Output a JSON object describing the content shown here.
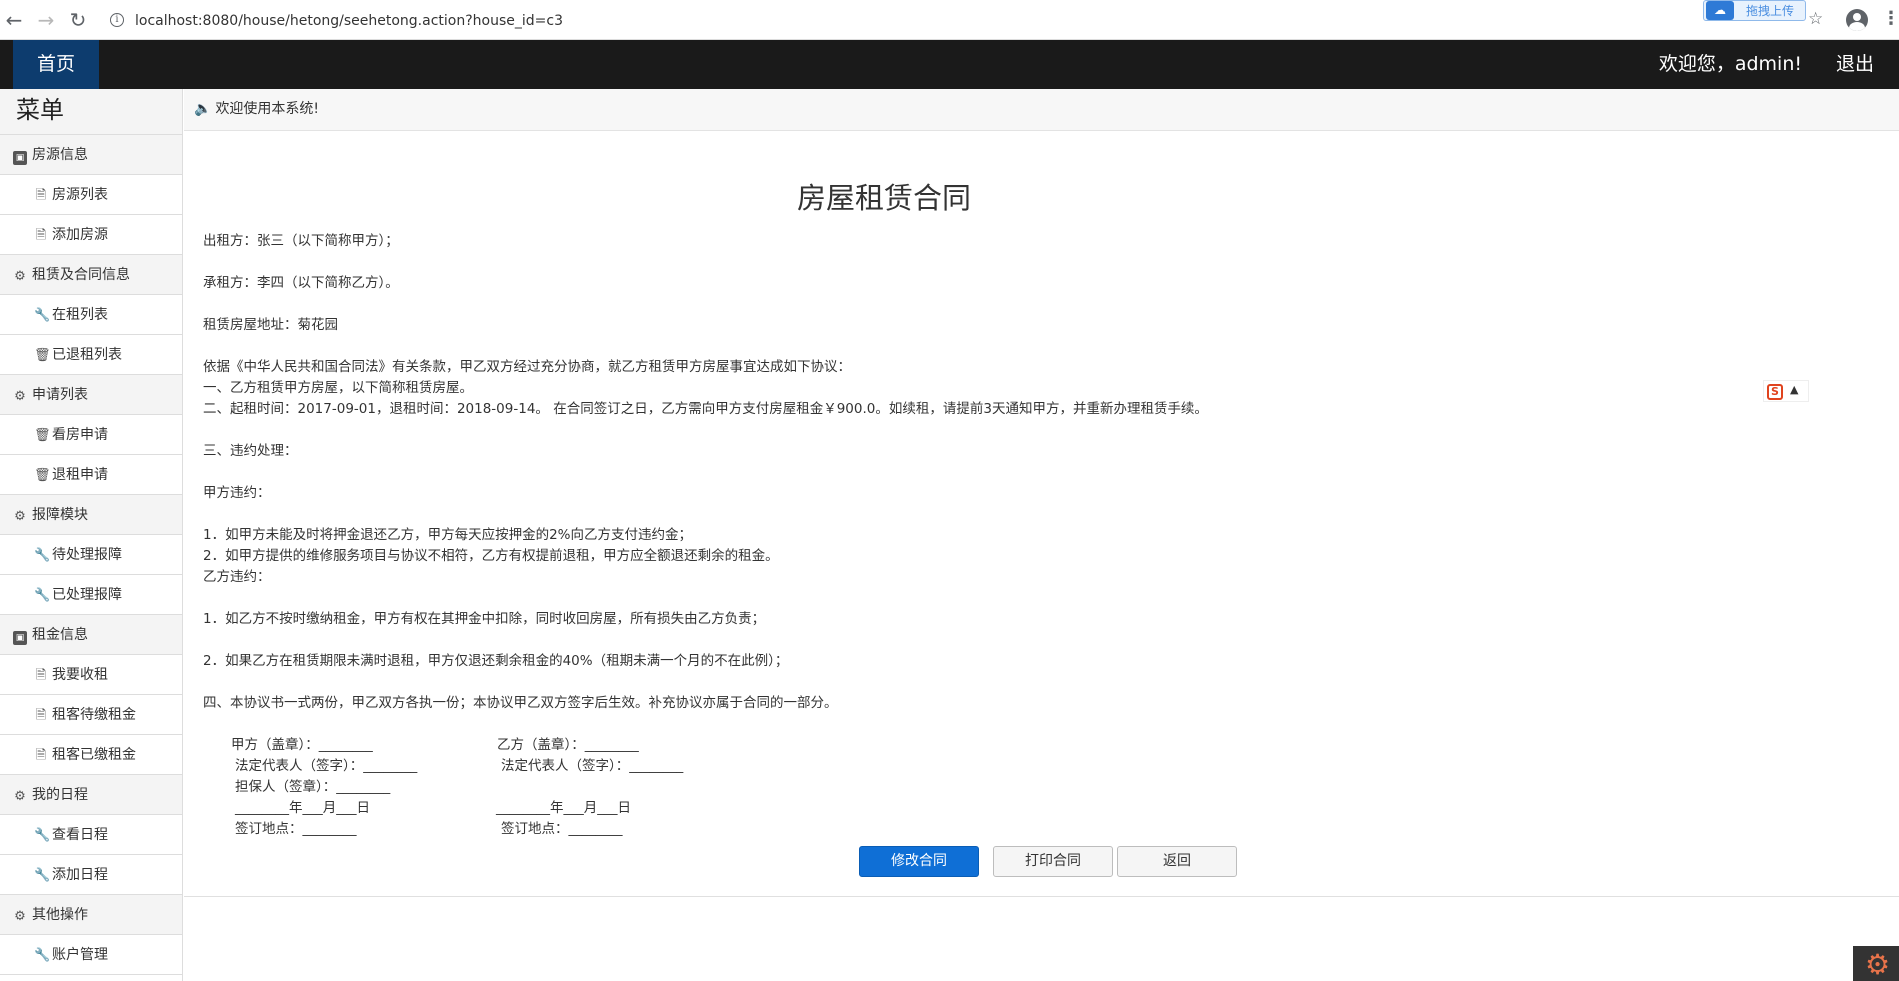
{
  "browser": {
    "url_host": "localhost",
    "url_path": ":8080/house/hetong/seehetong.action?house_id=c3",
    "upload_label": "拖拽上传"
  },
  "topbar": {
    "home": "首页",
    "welcome": "欢迎您，admin!",
    "logout": "退出"
  },
  "sidebar": {
    "title": "菜单",
    "groups": [
      {
        "label": "房源信息",
        "icon": "id-card-icon",
        "items": [
          "房源列表",
          "添加房源"
        ]
      },
      {
        "label": "租赁及合同信息",
        "icon": "gear-icon",
        "items": [
          "在租列表",
          "已退租列表"
        ]
      },
      {
        "label": "申请列表",
        "icon": "gear-icon",
        "items": [
          "看房申请",
          "退租申请"
        ]
      },
      {
        "label": "报障模块",
        "icon": "gear-icon",
        "items": [
          "待处理报障",
          "已处理报障"
        ]
      },
      {
        "label": "租金信息",
        "icon": "id-card-icon",
        "items": [
          "我要收租",
          "租客待缴租金",
          "租客已缴租金"
        ]
      },
      {
        "label": "我的日程",
        "icon": "gear-icon",
        "items": [
          "查看日程",
          "添加日程"
        ]
      },
      {
        "label": "其他操作",
        "icon": "gear-icon",
        "items": [
          "账户管理"
        ]
      }
    ]
  },
  "notice": "欢迎使用本系统!",
  "contract": {
    "title": "房屋租赁合同",
    "lines": [
      "出租方：张三（以下简称甲方）；",
      "承租方：李四（以下简称乙方）。",
      "租赁房屋地址：菊花园",
      "依据《中华人民共和国合同法》有关条款，甲乙双方经过充分协商，就乙方租赁甲方房屋事宜达成如下协议：",
      "一、乙方租赁甲方房屋，以下简称租赁房屋。",
      "二、起租时间：2017-09-01，退租时间：2018-09-14。 在合同签订之日，乙方需向甲方支付房屋租金￥900.0。如续租，请提前3天通知甲方，并重新办理租赁手续。",
      "三、违约处理：",
      "甲方违约：",
      "1．如甲方未能及时将押金退还乙方，甲方每天应按押金的2%向乙方支付违约金；",
      "2．如甲方提供的维修服务项目与协议不相符，乙方有权提前退租，甲方应全额退还剩余的租金。",
      "乙方违约：",
      "1．如乙方不按时缴纳租金，甲方有权在其押金中扣除，同时收回房屋，所有损失由乙方负责；",
      "2．如果乙方在租赁期限未满时退租，甲方仅退还剩余租金的40%（租期未满一个月的不在此例）；",
      "四、本协议书一式两份，甲乙双方各执一份；本协议甲乙双方签字后生效。补充协议亦属于合同的一部分。"
    ],
    "sign_left": [
      "甲方（盖章）：________",
      "法定代表人（签字）：________",
      "担保人（签章）：________",
      "________年___月___日",
      "签订地点：________"
    ],
    "sign_right": [
      "乙方（盖章）：________",
      "法定代表人（签字）：________",
      "________年___月___日",
      "签订地点：________"
    ]
  },
  "buttons": {
    "edit": "修改合同",
    "print": "打印合同",
    "back": "返回"
  }
}
